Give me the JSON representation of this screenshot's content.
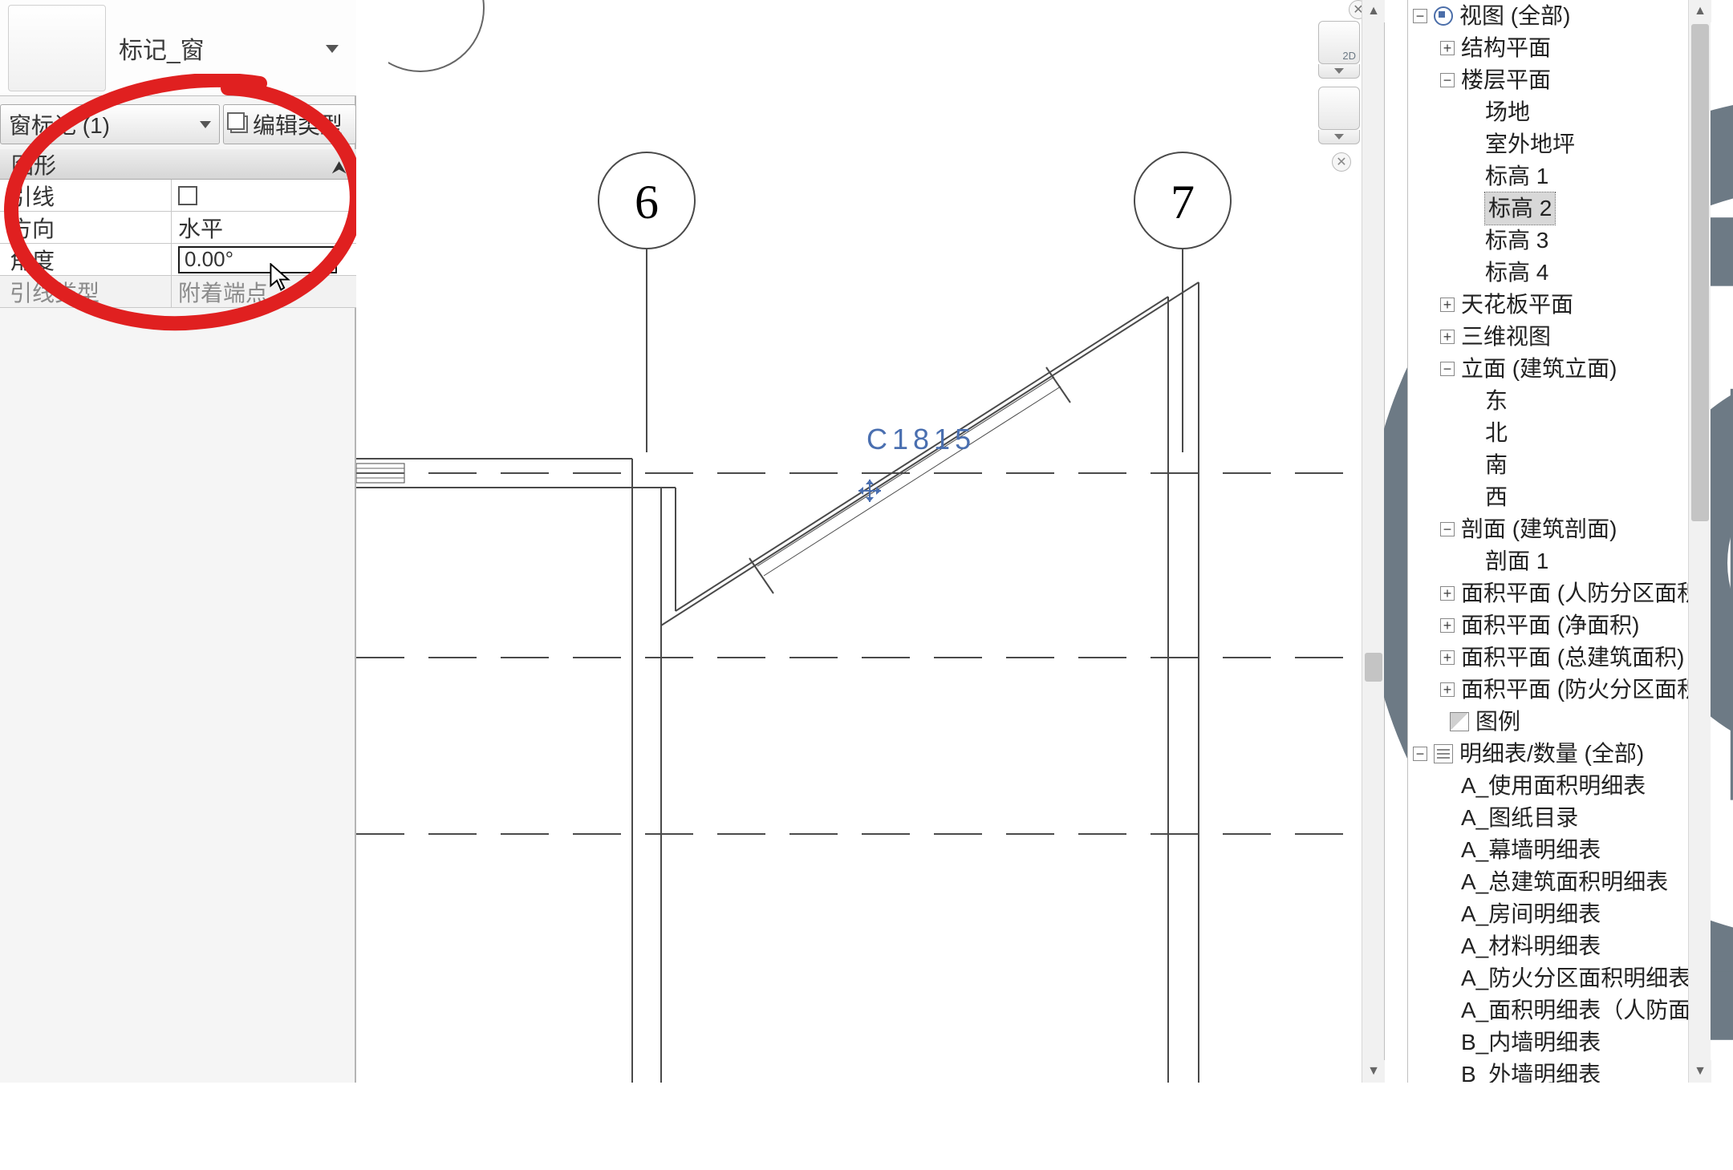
{
  "properties": {
    "type_selector": "标记_窗",
    "instance_button": "窗标记 (1)",
    "edit_type_button": "编辑类型",
    "graphics_header": "图形",
    "rows": {
      "leader_label": "引线",
      "orientation_label": "方向",
      "orientation_value": "水平",
      "angle_label": "角度",
      "angle_value": "0.00°",
      "leader_type_label": "引线类型",
      "leader_type_value": "附着端点"
    }
  },
  "canvas": {
    "grid_a": "6",
    "grid_b": "7",
    "tag_text": "C1815",
    "view_tool_2d": "2D"
  },
  "browser": {
    "root": "视图 (全部)",
    "struct": "结构平面",
    "floor": "楼层平面",
    "floor_items": [
      "场地",
      "室外地坪",
      "标高 1",
      "标高 2",
      "标高 3",
      "标高 4"
    ],
    "ceiling": "天花板平面",
    "threeD": "三维视图",
    "elev": "立面 (建筑立面)",
    "elev_items": [
      "东",
      "北",
      "南",
      "西"
    ],
    "section": "剖面 (建筑剖面)",
    "section_items": [
      "剖面 1"
    ],
    "area1": "面积平面 (人防分区面积)",
    "area2": "面积平面 (净面积)",
    "area3": "面积平面 (总建筑面积)",
    "area4": "面积平面 (防火分区面积)",
    "legend": "图例",
    "sched": "明细表/数量 (全部)",
    "sched_items": [
      "A_使用面积明细表",
      "A_图纸目录",
      "A_幕墙明细表",
      "A_总建筑面积明细表",
      "A_房间明细表",
      "A_材料明细表",
      "A_防火分区面积明细表",
      "A_面积明细表（人防面积）",
      "B_内墙明细表",
      "B_外墙明细表"
    ]
  }
}
